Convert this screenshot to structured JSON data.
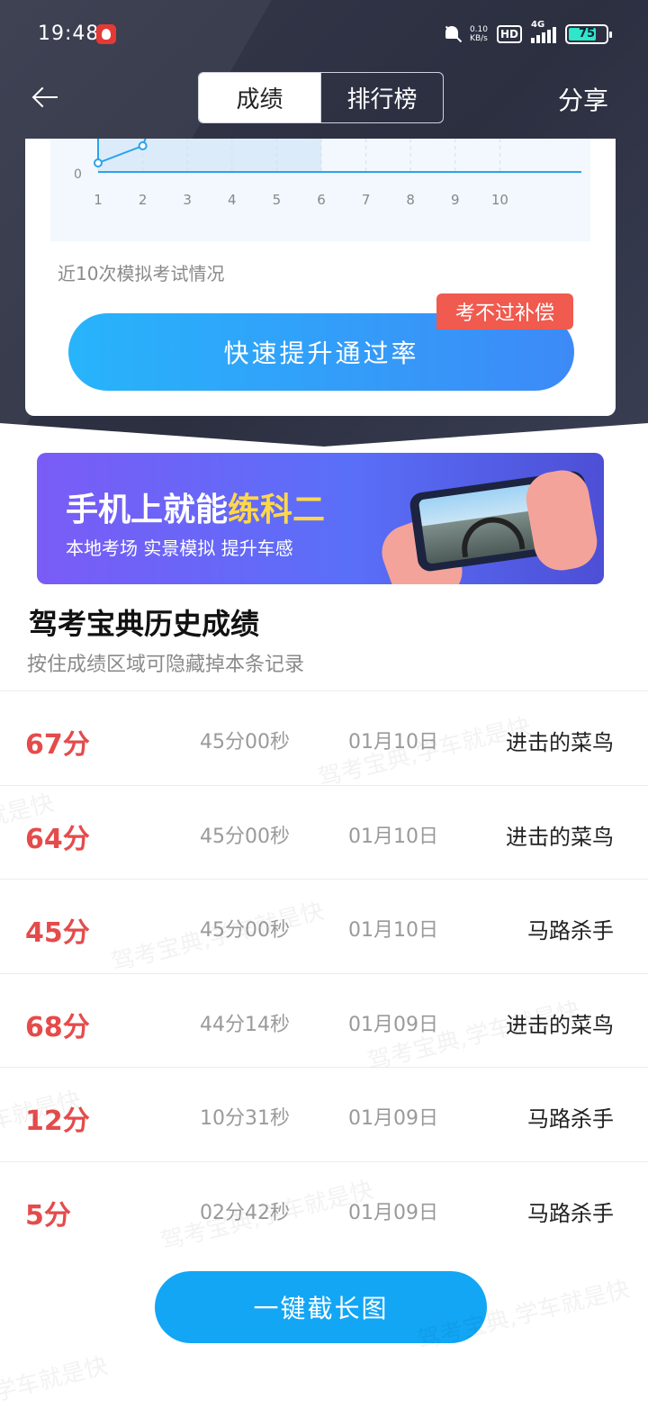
{
  "status_bar": {
    "time": "19:48",
    "net_speed_value": "0.10",
    "net_speed_unit": "KB/s",
    "hd": "HD",
    "network": "4G",
    "battery": "75"
  },
  "nav": {
    "tabs": [
      {
        "label": "成绩",
        "active": true
      },
      {
        "label": "排行榜",
        "active": false
      }
    ],
    "share_label": "分享"
  },
  "chart_data": {
    "type": "line",
    "x": [
      1,
      2,
      3,
      4,
      5,
      6,
      7,
      8,
      9,
      10
    ],
    "y_tick_visible": "0",
    "shaded_through": 6,
    "x_tick_labels": [
      "1",
      "2",
      "3",
      "4",
      "5",
      "6",
      "7",
      "8",
      "9",
      "10"
    ]
  },
  "card": {
    "caption": "近10次模拟考试情况",
    "cta_label": "快速提升通过率",
    "badge": "考不过补偿"
  },
  "banner": {
    "title_prefix": "手机上就能",
    "title_highlight": "练科二",
    "subtitle": "本地考场 实景模拟 提升车感"
  },
  "history": {
    "title": "驾考宝典历史成绩",
    "subtitle": "按住成绩区域可隐藏掉本条记录",
    "records": [
      {
        "score": "67分",
        "duration": "45分00秒",
        "date": "01月10日",
        "title": "进击的菜鸟"
      },
      {
        "score": "64分",
        "duration": "45分00秒",
        "date": "01月10日",
        "title": "进击的菜鸟"
      },
      {
        "score": "45分",
        "duration": "45分00秒",
        "date": "01月10日",
        "title": "马路杀手"
      },
      {
        "score": "68分",
        "duration": "44分14秒",
        "date": "01月09日",
        "title": "进击的菜鸟"
      },
      {
        "score": "12分",
        "duration": "10分31秒",
        "date": "01月09日",
        "title": "马路杀手"
      },
      {
        "score": "5分",
        "duration": "02分42秒",
        "date": "01月09日",
        "title": "马路杀手"
      }
    ]
  },
  "screenshot_button": "一键截长图",
  "watermark": "驾考宝典,学车就是快",
  "colors": {
    "accent_blue": "#12a6f5",
    "score_red": "#e54b4b",
    "badge_red": "#f05a4f",
    "header_dark": "#2f3344"
  }
}
